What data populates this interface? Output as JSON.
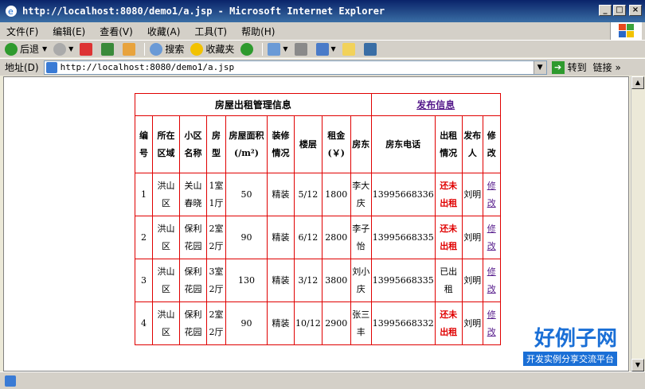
{
  "window": {
    "title": "http://localhost:8080/demo1/a.jsp - Microsoft Internet Explorer"
  },
  "menu": [
    "文件(F)",
    "编辑(E)",
    "查看(V)",
    "收藏(A)",
    "工具(T)",
    "帮助(H)"
  ],
  "toolbar": {
    "back": "后退",
    "search": "搜索",
    "favorites": "收藏夹"
  },
  "address": {
    "label": "地址(D)",
    "url": "http://localhost:8080/demo1/a.jsp",
    "go": "转到",
    "links": "链接"
  },
  "table": {
    "title": "房屋出租管理信息",
    "publish": "发布信息",
    "headers": [
      "编号",
      "所在区域",
      "小区名称",
      "房型",
      "房屋面积(/m²)",
      "装修情况",
      "楼层",
      "租金(￥)",
      "房东",
      "房东电话",
      "出租情况",
      "发布人",
      "修改"
    ],
    "rows": [
      {
        "id": "1",
        "area": "洪山区",
        "community": "关山春晓",
        "type": "1室1厅",
        "size": "50",
        "decor": "精装",
        "floor": "5/12",
        "rent": "1800",
        "owner": "李大庆",
        "phone": "13995668336",
        "status": "还未出租",
        "publisher": "刘明",
        "edit": "修改"
      },
      {
        "id": "2",
        "area": "洪山区",
        "community": "保利花园",
        "type": "2室2厅",
        "size": "90",
        "decor": "精装",
        "floor": "6/12",
        "rent": "2800",
        "owner": "李子怡",
        "phone": "13995668335",
        "status": "还未出租",
        "publisher": "刘明",
        "edit": "修改"
      },
      {
        "id": "3",
        "area": "洪山区",
        "community": "保利花园",
        "type": "3室2厅",
        "size": "130",
        "decor": "精装",
        "floor": "3/12",
        "rent": "3800",
        "owner": "刘小庆",
        "phone": "13995668335",
        "status": "已出租",
        "publisher": "刘明",
        "edit": "修改"
      },
      {
        "id": "4",
        "area": "洪山区",
        "community": "保利花园",
        "type": "2室2厅",
        "size": "90",
        "decor": "精装",
        "floor": "10/12",
        "rent": "2900",
        "owner": "张三丰",
        "phone": "13995668332",
        "status": "还未出租",
        "publisher": "刘明",
        "edit": "修改"
      }
    ]
  },
  "watermark": {
    "logo": "好例子网",
    "tagline": "开发实例分享交流平台"
  },
  "colors": {
    "border": "#e00000",
    "link": "#551a8b",
    "status_red": "#e00000"
  }
}
